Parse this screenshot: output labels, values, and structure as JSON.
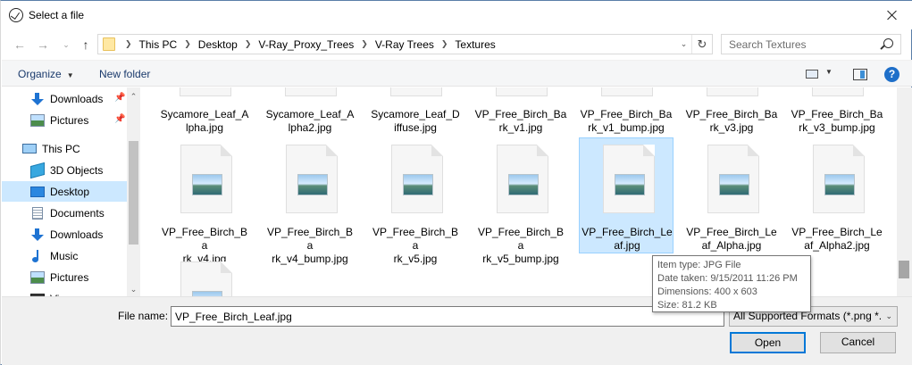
{
  "window": {
    "title": "Select a file"
  },
  "address": {
    "crumbs": [
      "This PC",
      "Desktop",
      "V-Ray_Proxy_Trees",
      "V-Ray Trees",
      "Textures"
    ]
  },
  "search": {
    "placeholder": "Search Textures"
  },
  "toolbar": {
    "organize_label": "Organize",
    "new_folder_label": "New folder",
    "help_label": "?"
  },
  "sidebar": {
    "items": [
      {
        "label": "Downloads",
        "icon": "download-icon",
        "pinned": true
      },
      {
        "label": "Pictures",
        "icon": "pictures-icon",
        "pinned": true
      },
      {
        "label": "This PC",
        "icon": "computer-icon"
      },
      {
        "label": "3D Objects",
        "icon": "3d-objects-icon"
      },
      {
        "label": "Desktop",
        "icon": "desktop-icon",
        "selected": true
      },
      {
        "label": "Documents",
        "icon": "documents-icon"
      },
      {
        "label": "Downloads",
        "icon": "download-icon"
      },
      {
        "label": "Music",
        "icon": "music-icon"
      },
      {
        "label": "Pictures",
        "icon": "pictures-icon"
      },
      {
        "label": "Vi",
        "icon": "videos-icon"
      }
    ]
  },
  "files": {
    "row1": [
      {
        "line1": "Sycamore_Leaf_A",
        "line2": "lpha.jpg"
      },
      {
        "line1": "Sycamore_Leaf_A",
        "line2": "lpha2.jpg"
      },
      {
        "line1": "Sycamore_Leaf_D",
        "line2": "iffuse.jpg"
      },
      {
        "line1": "VP_Free_Birch_Ba",
        "line2": "rk_v1.jpg"
      },
      {
        "line1": "VP_Free_Birch_Ba",
        "line2": "rk_v1_bump.jpg"
      },
      {
        "line1": "VP_Free_Birch_Ba",
        "line2": "rk_v3.jpg"
      },
      {
        "line1": "VP_Free_Birch_Ba",
        "line2": "rk_v3_bump.jpg"
      }
    ],
    "row2": [
      {
        "line1": "VP_Free_Birch_Ba",
        "line2": "rk_v4.jpg"
      },
      {
        "line1": "VP_Free_Birch_Ba",
        "line2": "rk_v4_bump.jpg"
      },
      {
        "line1": "VP_Free_Birch_Ba",
        "line2": "rk_v5.jpg"
      },
      {
        "line1": "VP_Free_Birch_Ba",
        "line2": "rk_v5_bump.jpg"
      },
      {
        "line1": "VP_Free_Birch_Le",
        "line2": "af.jpg",
        "selected": true
      },
      {
        "line1": "VP_Free_Birch_Le",
        "line2": "af_Alpha.jpg"
      },
      {
        "line1": "VP_Free_Birch_Le",
        "line2": "af_Alpha2.jpg"
      }
    ]
  },
  "tooltip": {
    "type": "Item type: JPG File",
    "date": "Date taken: 9/15/2011 11:26 PM",
    "dimensions": "Dimensions: 400 x 603",
    "size": "Size: 81.2 KB"
  },
  "bottom": {
    "file_name_label": "File name:",
    "file_name_value": "VP_Free_Birch_Leaf.jpg",
    "filter_value": "All Supported Formats (*.png *.",
    "open_label": "Open",
    "cancel_label": "Cancel"
  },
  "colors": {
    "selection": "#cce8ff",
    "accent": "#0078d7"
  }
}
